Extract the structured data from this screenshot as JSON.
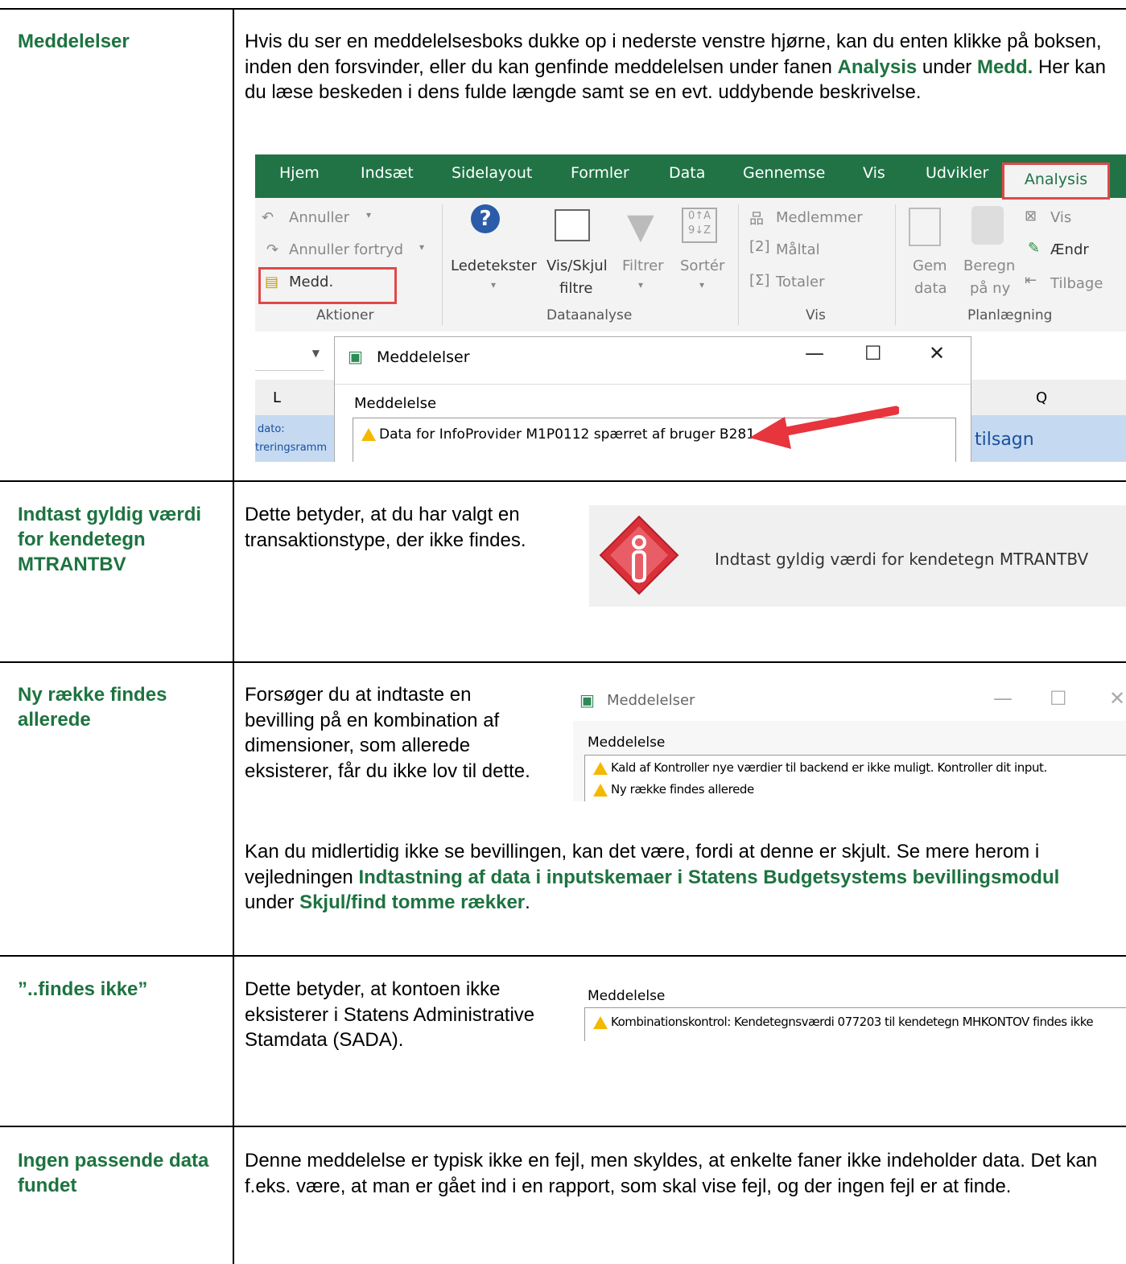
{
  "rows": [
    {
      "term": "Meddelelser",
      "desc_parts": [
        "Hvis du ser en meddelelsesboks dukke op i nederste venstre hjørne, kan du enten klikke på boksen, inden den forsvinder, eller du kan genfinde meddelelsen under fanen ",
        "Analysis",
        " under ",
        "Medd.",
        " Her kan du læse beskeden i dens fulde længde samt se en evt. uddybende beskrivelse."
      ]
    },
    {
      "term": "Indtast gyldig værdi for kendetegn MTRANTBV",
      "desc": "Dette betyder, at du har valgt en transaktionstype, der ikke findes."
    },
    {
      "term": "Ny række findes allerede",
      "desc": "Forsøger du at indtaste en bevilling på en kombination af dimensioner, som allerede eksisterer, får du ikke lov til dette.",
      "desc2_parts": [
        "Kan du midlertidig ikke se bevillingen, kan det være, fordi at denne er skjult. Se mere herom i vejledningen ",
        "Indtastning af data i inputskemaer i Statens Budgetsystems bevillingsmodul",
        " under ",
        "Skjul/find tomme rækker",
        "."
      ]
    },
    {
      "term": "”..findes ikke”",
      "desc": "Dette betyder, at kontoen ikke eksisterer i Statens Administrative Stamdata (SADA)."
    },
    {
      "term": "Ingen passende data fundet",
      "desc": "Denne meddelelse er typisk ikke en fejl, men skyldes, at enkelte faner ikke indeholder data. Det kan f.eks. være, at man er gået ind i en rapport, som skal vise fejl, og der ingen fejl er at finde."
    }
  ],
  "excel": {
    "tabs": [
      "Hjem",
      "Indsæt",
      "Sidelayout",
      "Formler",
      "Data",
      "Gennemse",
      "Vis",
      "Udvikler",
      "Analysis"
    ],
    "ribbon": {
      "annuller": "Annuller",
      "annuller_fortryd": "Annuller fortryd",
      "medd": "Medd.",
      "aktioner": "Aktioner",
      "ledetekster": "Ledetekster",
      "vis_skjul": "Vis/Skjul",
      "filtre": "filtre",
      "filtrer": "Filtrer",
      "sorter": "Sortér",
      "dataanalyse": "Dataanalyse",
      "medlemmer": "Medlemmer",
      "maltal": "Måltal",
      "totaler": "Totaler",
      "vis_group": "Vis",
      "gem": "Gem",
      "data": "data",
      "beregn": "Beregn",
      "pa_ny": "på ny",
      "vis_btn": "Vis",
      "aendr": "Ændr",
      "tilbage": "Tilbage",
      "planlaegning": "Planlægning"
    },
    "sheet": {
      "col_l": "L",
      "col_q": "Q",
      "cell1": "dato:",
      "cell2": "treringsramm",
      "cell3": "tilsagn"
    },
    "dialog": {
      "title": "Meddelelser",
      "label": "Meddelelse",
      "msg": "Data for InfoProvider M1P0112 spærret af bruger B281"
    }
  },
  "infobox_msg": "Indtast gyldig værdi for kendetegn MTRANTBV",
  "dialog3": {
    "title": "Meddelelser",
    "label": "Meddelelse",
    "msg1": "Kald af Kontroller nye værdier til backend er ikke muligt. Kontroller dit input.",
    "msg2": "Ny række findes allerede"
  },
  "dialog4": {
    "label": "Meddelelse",
    "msg": "Kombinationskontrol: Kendetegnsværdi 077203 til kendetegn MHKONTOV findes ikke"
  },
  "colors": {
    "green": "#1d7340",
    "excel_green": "#217346",
    "red": "#e04848"
  }
}
